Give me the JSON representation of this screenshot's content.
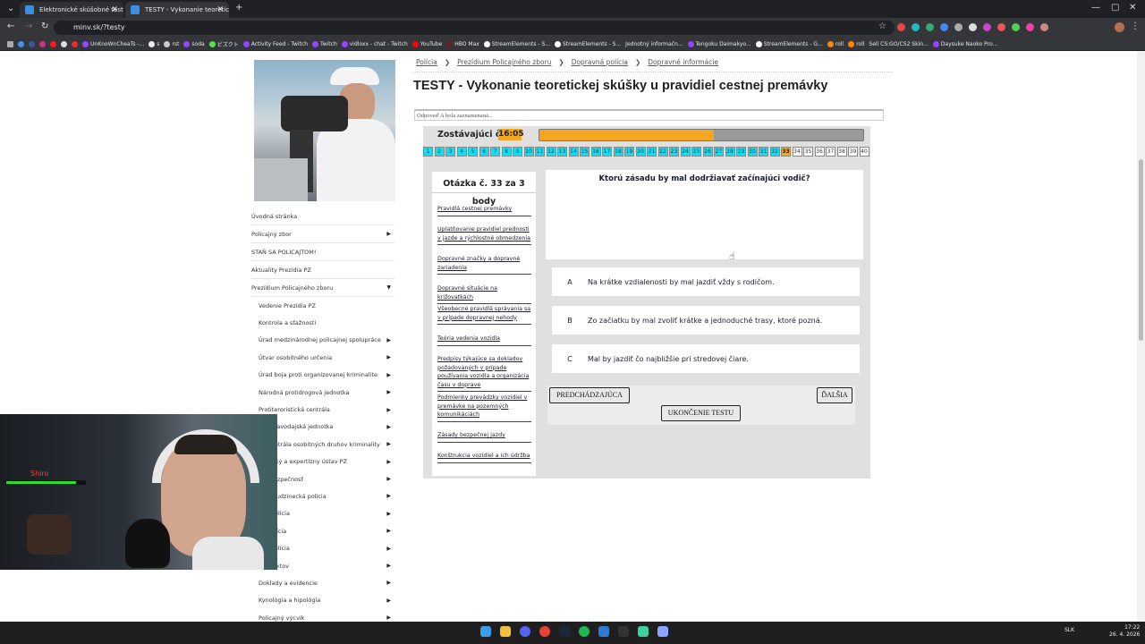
{
  "browser": {
    "tabs": [
      {
        "title": "Elektronické skúšobné testy, M",
        "active": false
      },
      {
        "title": "TESTY - Vykonanie teoretickej",
        "active": true
      }
    ],
    "url": "minv.sk/?testy",
    "bookmarks": [
      "s",
      "rst",
      "soda",
      "ビズクト",
      "Activity Feed - Twitch",
      "Twitch",
      "vidloxx - chat - Twitch",
      "YouTube",
      "HBO Max",
      "StreamElements - S...",
      "StreamElements - S...",
      "Jednotný informačn...",
      "Tengoku Daimakyo...",
      "StreamElements - G...",
      "roll",
      "roll",
      "Sell CS:GO/CS2 Skin...",
      "Daysuke Naoko Pro..."
    ],
    "bookmark_first": "UnKnoWnCheaTs -..."
  },
  "sidebar": {
    "items": [
      {
        "label": "Úvodná stránka",
        "arrow": ""
      },
      {
        "label": "Policajný zbor",
        "arrow": "▶"
      },
      {
        "label": "STAŇ SA POLICAJTOM!",
        "arrow": ""
      },
      {
        "label": "Aktuality Prezídia PZ",
        "arrow": ""
      },
      {
        "label": "Prezídium Policajného zboru",
        "arrow": "▼"
      }
    ],
    "subitems": [
      {
        "label": "Vedenie Prezídia PZ",
        "arrow": ""
      },
      {
        "label": "Kontrola a sťažnosti",
        "arrow": ""
      },
      {
        "label": "Úrad medzinárodnej policajnej spolupráce",
        "arrow": "▶"
      },
      {
        "label": "Útvar osobitného určenia",
        "arrow": "▶"
      },
      {
        "label": "Úrad boja proti organizovanej kriminalite",
        "arrow": "▶"
      },
      {
        "label": "Národná protidrogová jednotka",
        "arrow": "▶"
      },
      {
        "label": "Protiteroristická centrála",
        "arrow": "▶"
      },
      {
        "label": "ná spravodajská jednotka",
        "arrow": "▶"
      },
      {
        "label": "ná centrála osobitných druhov kriminality",
        "arrow": "▶"
      },
      {
        "label": "alistický a expertízny ústav PZ",
        "arrow": "▶"
      },
      {
        "label": "rná bezpečnosť",
        "arrow": "▶"
      },
      {
        "label": "ná a cudzinecká polícia",
        "arrow": "▶"
      },
      {
        "label": "ová polícia",
        "arrow": "▶"
      },
      {
        "label": "ná polícia",
        "arrow": "▶"
      },
      {
        "label": "čná polícia",
        "arrow": "▶"
      },
      {
        "label": "a objektov",
        "arrow": "▶"
      },
      {
        "label": "Doklady a evidencie",
        "arrow": "▶"
      },
      {
        "label": "Kynológia a hipológia",
        "arrow": "▶"
      },
      {
        "label": "Policajný výcvik",
        "arrow": "▶"
      }
    ]
  },
  "breadcrumb": [
    "Polícia",
    "Prezídium Policajného zboru",
    "Dopravná polícia",
    "Dopravné informácie"
  ],
  "breadcrumb_sep": "❯",
  "page_title": "TESTY - Vykonanie teoretickej skúšky u pravidiel cestnej premávky",
  "notice": "Odpoveď A bola zaznamenaná...",
  "test": {
    "time_label": "Zostávajúci čas",
    "time_value": "16:05",
    "time_remaining_fraction": 0.54,
    "current_question": 33,
    "total_questions": 40,
    "question_header": "Otázka č. 33 za 3 body",
    "categories": [
      "Pravidlá cestnej premávky",
      "Uplatňovanie pravidiel prednosti v jazde a rýchlostné obmedzenia",
      "Dopravné značky a dopravné zariadenia",
      "Dopravné situácie na križovatkách",
      "Všeobecné pravidlá správania sa v prípade dopravnej nehody",
      "Teória vedenia vozidla",
      "Predpisy týkajúce sa dokladov požadovaných v prípade používania vozidla a organizácia času v doprave",
      "Podmienky prevádzky vozidiel v premávke na pozemných komunikáciách",
      "Zásady bezpečnej jazdy",
      "Konštrukcia vozidiel a ich údržba"
    ],
    "question": "Ktorú zásadu by mal dodržiavať začínajúci vodič?",
    "answers": [
      {
        "letter": "A",
        "text": "Na krátke vzdialenosti by mal jazdiť vždy s rodičom."
      },
      {
        "letter": "B",
        "text": "Zo začiatku by mal zvoliť krátke a jednoduché trasy, ktoré pozná."
      },
      {
        "letter": "C",
        "text": "Mal by jazdiť čo najbližšie pri stredovej čiare."
      }
    ],
    "buttons": {
      "prev": "PREDCHÁDZAJÚCA",
      "next": "ĎALŠIA",
      "finish": "UKONČENIE TESTU"
    }
  },
  "stream": {
    "name": "Shiro",
    "health_fraction": 0.87
  },
  "taskbar": {
    "lang": "SLK",
    "time": "17:22",
    "date": "26. 4. 2026"
  },
  "colors": {
    "timer": "#f5a623",
    "answered": "#00e5ff",
    "current": "#f5a623"
  }
}
